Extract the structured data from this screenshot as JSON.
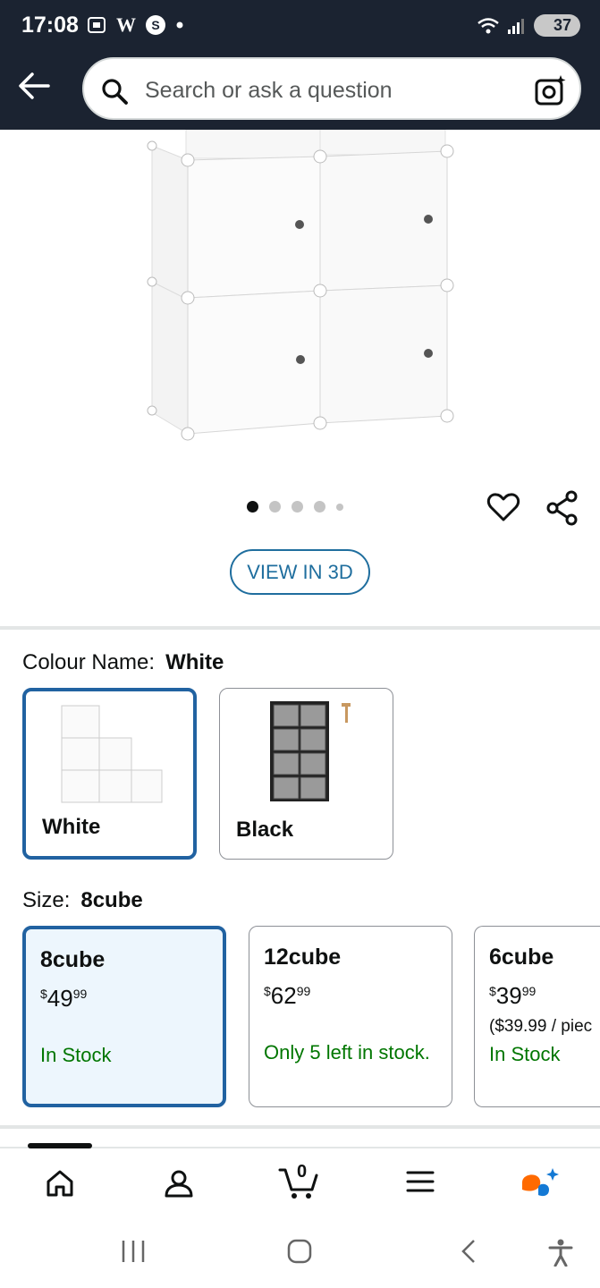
{
  "status_bar": {
    "time": "17:08",
    "letter": "W",
    "battery": "37"
  },
  "search": {
    "placeholder": "Search or ask a question"
  },
  "gallery": {
    "dot_count": 5,
    "active_dot": 0
  },
  "view3d": {
    "label": "VIEW IN 3D"
  },
  "colour": {
    "label": "Colour Name:",
    "selected": "White",
    "options": [
      "White",
      "Black"
    ]
  },
  "size": {
    "label": "Size:",
    "selected": "8cube",
    "options": [
      {
        "name": "8cube",
        "price_main": "49",
        "price_cents": "99",
        "unit": "",
        "stock": "In Stock"
      },
      {
        "name": "12cube",
        "price_main": "62",
        "price_cents": "99",
        "unit": "",
        "stock": "Only 5 left in stock."
      },
      {
        "name": "6cube",
        "price_main": "39",
        "price_cents": "99",
        "unit": "($39.99 / piec",
        "stock": "In Stock"
      }
    ]
  },
  "bottom_nav": {
    "cart_count": "0",
    "items": [
      "home-icon",
      "account-icon",
      "cart-icon",
      "menu-icon",
      "rufus-icon"
    ]
  },
  "colors": {
    "header_bg": "#1b2331",
    "selected_border": "#2162a1",
    "in_stock": "#007600",
    "link": "#1f6e9e"
  }
}
